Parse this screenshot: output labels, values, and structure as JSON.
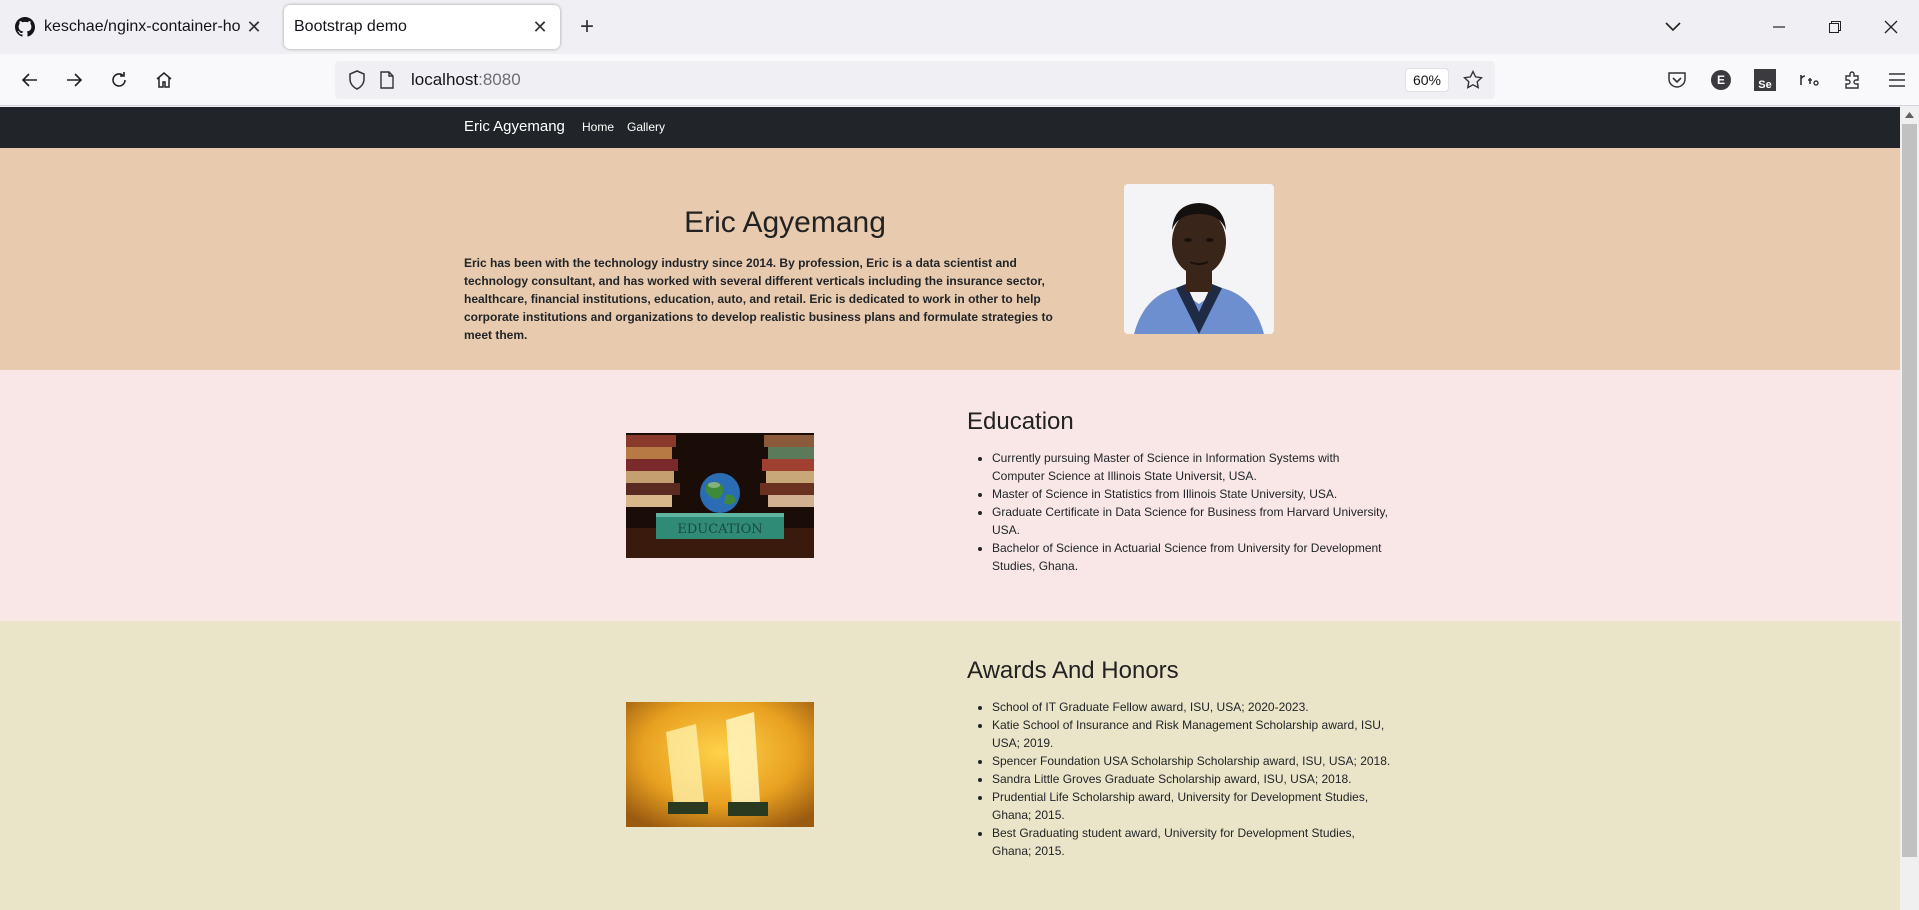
{
  "browser": {
    "tabs": [
      {
        "title": "keschae/nginx-container-host",
        "icon": "github-icon"
      },
      {
        "title": "Bootstrap demo",
        "icon": ""
      }
    ],
    "url_host": "localhost",
    "url_port": ":8080",
    "zoom": "60%",
    "extensions": {
      "e_badge": "E",
      "se_badge": "Se"
    }
  },
  "site": {
    "brand": "Eric Agyemang",
    "nav": [
      "Home",
      "Gallery"
    ],
    "hero": {
      "title": "Eric Agyemang",
      "text": "Eric has been with the technology industry since 2014. By profession, Eric is a data scientist and technology consultant, and has worked with several different verticals including the insurance sector, healthcare, financial institutions, education, auto, and retail. Eric is dedicated to work in other to help corporate institutions and organizations to develop realistic business plans and formulate strategies to meet them.",
      "bg": "#e8cbae"
    },
    "education": {
      "title": "Education",
      "bg": "#f9e7e7",
      "items": [
        "Currently pursuing Master of Science in Information Systems with Computer Science at Illinois State Universit, USA.",
        "Master of Science in Statistics from Illinois State University, USA.",
        "Graduate Certificate in Data Science for Business from Harvard University, USA.",
        "Bachelor of Science in Actuarial Science from University for Development Studies, Ghana."
      ],
      "image_caption": "EDUCATION"
    },
    "awards": {
      "title": "Awards And Honors",
      "bg": "#eae5c8",
      "items": [
        "School of IT Graduate Fellow award, ISU, USA; 2020-2023.",
        "Katie School of Insurance and Risk Management Scholarship award, ISU, USA; 2019.",
        "Spencer Foundation USA Scholarship Scholarship award, ISU, USA; 2018.",
        "Sandra Little Groves Graduate Scholarship award, ISU, USA; 2018.",
        "Prudential Life Scholarship award, University for Development Studies, Ghana; 2015.",
        "Best Graduating student award, University for Development Studies, Ghana; 2015."
      ]
    }
  }
}
